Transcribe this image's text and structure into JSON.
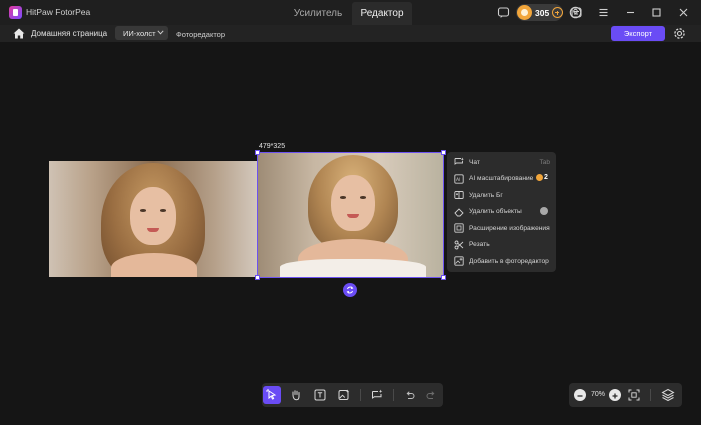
{
  "app": {
    "name": "HitPaw FotorPea"
  },
  "mode_tabs": [
    {
      "label": "Усилитель",
      "active": false
    },
    {
      "label": "Редактор",
      "active": true
    }
  ],
  "titlebar": {
    "credits": "305",
    "icons": [
      "chat-bubble-icon",
      "coin-icon",
      "add-credits-icon",
      "menu-icon",
      "user-icon",
      "hamburger-icon",
      "minimize-icon",
      "maximize-icon",
      "close-icon"
    ]
  },
  "toolbar": {
    "home_label": "Домашняя страница",
    "canvas_select": "ИИ-холст",
    "editor_label": "Фоторедактор",
    "export_label": "Экспорт"
  },
  "canvas": {
    "size_label": "479*325"
  },
  "context_menu": {
    "items": [
      {
        "label": "Чат",
        "hint": "Tab",
        "icon": "chat-sparkle-icon"
      },
      {
        "label": "AI масштабирование",
        "cost": "2",
        "icon": "ai-upscale-icon"
      },
      {
        "label": "Удалить Бг",
        "icon": "remove-bg-icon"
      },
      {
        "label": "Удалить объекты",
        "icon": "eraser-icon"
      },
      {
        "label": "Расширение изображения",
        "icon": "expand-icon"
      },
      {
        "label": "Резать",
        "icon": "scissors-icon"
      },
      {
        "label": "Добавить в фоторедактор",
        "icon": "add-to-editor-icon"
      }
    ]
  },
  "bottom_tools": [
    "select-pointer-icon",
    "hand-icon",
    "text-icon",
    "image-add-icon",
    "ai-sparkle-chat-icon",
    "undo-icon",
    "redo-icon"
  ],
  "zoom": {
    "value": "70%"
  },
  "colors": {
    "accent": "#6a4cf5",
    "coin": "#f2a63b",
    "background": "#151515"
  }
}
